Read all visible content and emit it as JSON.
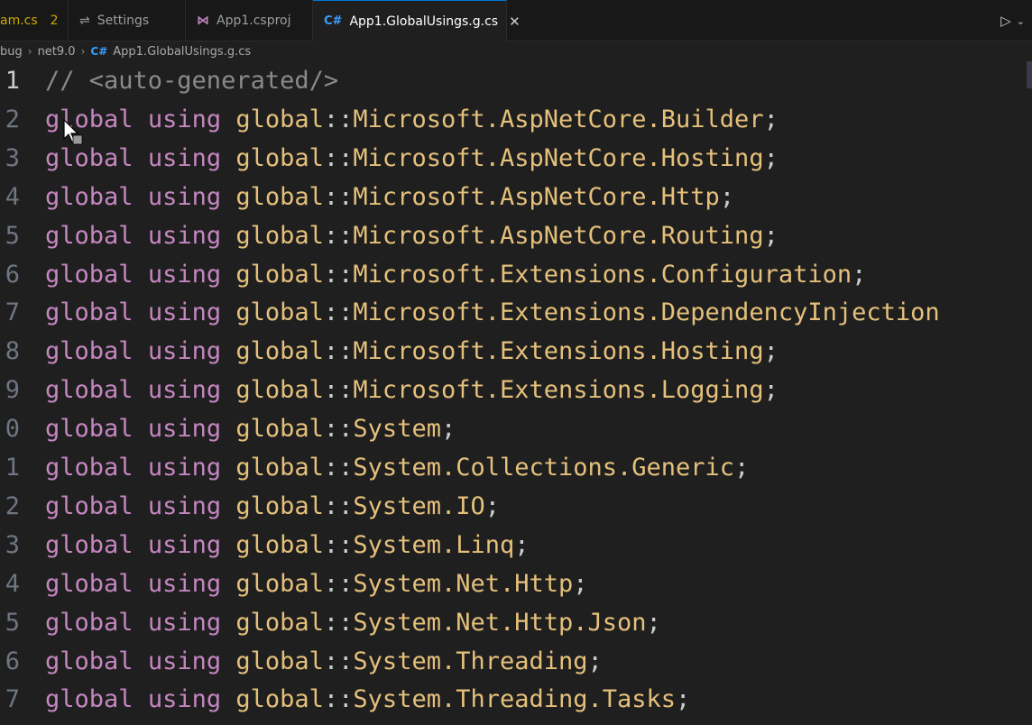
{
  "tabs": [
    {
      "label": "am.cs",
      "badge": "2",
      "icon": "none"
    },
    {
      "label": "Settings",
      "icon": "settings-icon"
    },
    {
      "label": "App1.csproj",
      "icon": "visual-studio-icon"
    },
    {
      "label": "App1.GlobalUsings.g.cs",
      "icon": "csharp-icon",
      "active": true
    }
  ],
  "tab_actions": {
    "run_icon": "run-icon",
    "chevron_icon": "chevron-down-icon"
  },
  "breadcrumb": [
    "bug",
    "net9.0",
    "App1.GlobalUsings.g.cs"
  ],
  "lines": [
    {
      "num": "1",
      "comment": "// <auto-generated/>"
    },
    {
      "num": "2",
      "kw1": "global",
      "kw2": "using",
      "prefix": "global",
      "sep": "::",
      "ns": "Microsoft.AspNetCore.Builder",
      "end": ";"
    },
    {
      "num": "3",
      "kw1": "global",
      "kw2": "using",
      "prefix": "global",
      "sep": "::",
      "ns": "Microsoft.AspNetCore.Hosting",
      "end": ";"
    },
    {
      "num": "4",
      "kw1": "global",
      "kw2": "using",
      "prefix": "global",
      "sep": "::",
      "ns": "Microsoft.AspNetCore.Http",
      "end": ";"
    },
    {
      "num": "5",
      "kw1": "global",
      "kw2": "using",
      "prefix": "global",
      "sep": "::",
      "ns": "Microsoft.AspNetCore.Routing",
      "end": ";"
    },
    {
      "num": "6",
      "kw1": "global",
      "kw2": "using",
      "prefix": "global",
      "sep": "::",
      "ns": "Microsoft.Extensions.Configuration",
      "end": ";"
    },
    {
      "num": "7",
      "kw1": "global",
      "kw2": "using",
      "prefix": "global",
      "sep": "::",
      "ns": "Microsoft.Extensions.DependencyInjection",
      "end": ""
    },
    {
      "num": "8",
      "kw1": "global",
      "kw2": "using",
      "prefix": "global",
      "sep": "::",
      "ns": "Microsoft.Extensions.Hosting",
      "end": ";"
    },
    {
      "num": "9",
      "kw1": "global",
      "kw2": "using",
      "prefix": "global",
      "sep": "::",
      "ns": "Microsoft.Extensions.Logging",
      "end": ";"
    },
    {
      "num": "0",
      "kw1": "global",
      "kw2": "using",
      "prefix": "global",
      "sep": "::",
      "ns": "System",
      "end": ";"
    },
    {
      "num": "1",
      "kw1": "global",
      "kw2": "using",
      "prefix": "global",
      "sep": "::",
      "ns": "System.Collections.Generic",
      "end": ";"
    },
    {
      "num": "2",
      "kw1": "global",
      "kw2": "using",
      "prefix": "global",
      "sep": "::",
      "ns": "System.IO",
      "end": ";"
    },
    {
      "num": "3",
      "kw1": "global",
      "kw2": "using",
      "prefix": "global",
      "sep": "::",
      "ns": "System.Linq",
      "end": ";"
    },
    {
      "num": "4",
      "kw1": "global",
      "kw2": "using",
      "prefix": "global",
      "sep": "::",
      "ns": "System.Net.Http",
      "end": ";"
    },
    {
      "num": "5",
      "kw1": "global",
      "kw2": "using",
      "prefix": "global",
      "sep": "::",
      "ns": "System.Net.Http.Json",
      "end": ";"
    },
    {
      "num": "6",
      "kw1": "global",
      "kw2": "using",
      "prefix": "global",
      "sep": "::",
      "ns": "System.Threading",
      "end": ";"
    },
    {
      "num": "7",
      "kw1": "global",
      "kw2": "using",
      "prefix": "global",
      "sep": "::",
      "ns": "System.Threading.Tasks",
      "end": ";"
    }
  ],
  "colors": {
    "background": "#1f1f1f",
    "keyword": "#c586c0",
    "namespace": "#e5c07b",
    "line_number": "#6e7681",
    "accent": "#0078d4"
  }
}
